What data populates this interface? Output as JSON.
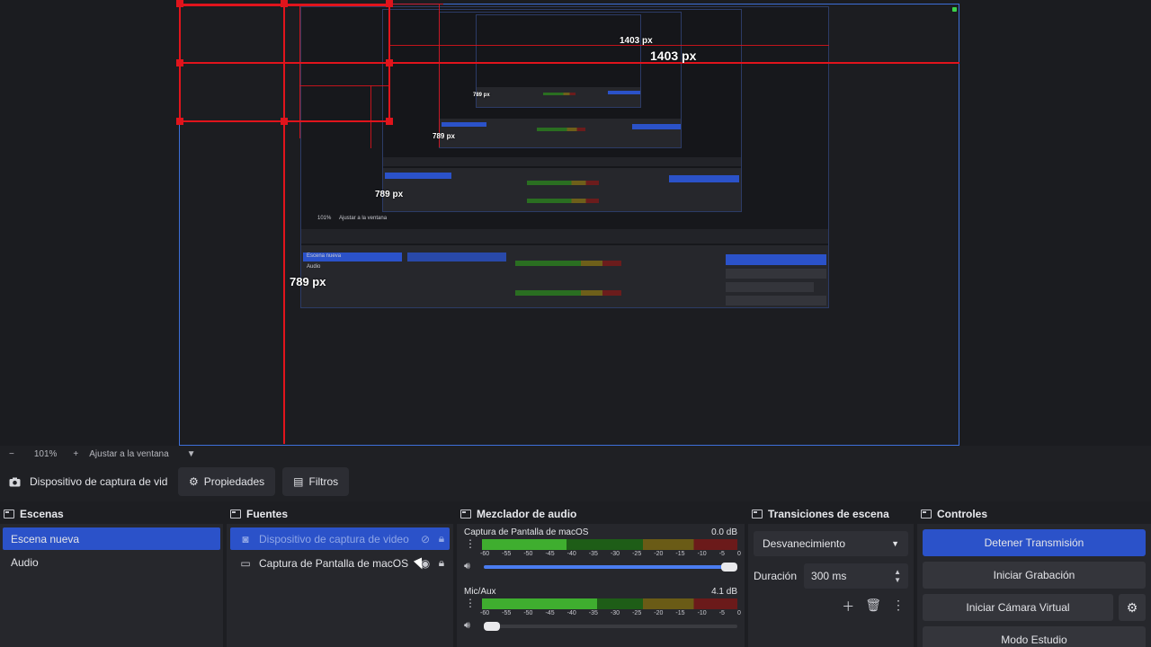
{
  "preview": {
    "labels": [
      "1403 px",
      "1403 px",
      "789 px",
      "789 px",
      "789 px",
      "789 px"
    ],
    "nested_scenes": [
      "Escena nueva",
      "Audio"
    ],
    "nested_zoom": "101%",
    "nested_fit": "Ajustar a la ventana"
  },
  "zoombar": {
    "minus": "−",
    "zoom": "101%",
    "plus": "+",
    "fit": "Ajustar a la ventana",
    "menu": "▼"
  },
  "source_toolbar": {
    "source_name": "Dispositivo de captura de vid",
    "properties_label": "Propiedades",
    "filters_label": "Filtros"
  },
  "scenes": {
    "title": "Escenas",
    "items": [
      {
        "label": "Escena nueva"
      },
      {
        "label": "Audio"
      }
    ]
  },
  "sources": {
    "title": "Fuentes",
    "items": [
      {
        "label": "Dispositivo de captura de video"
      },
      {
        "label": "Captura de Pantalla de macOS"
      }
    ]
  },
  "mixer": {
    "title": "Mezclador de audio",
    "ticks": [
      "-60",
      "-55",
      "-50",
      "-45",
      "-40",
      "-35",
      "-30",
      "-25",
      "-20",
      "-15",
      "-10",
      "-5",
      "0"
    ],
    "channels": [
      {
        "name": "Captura de Pantalla de macOS",
        "db": "0.0 dB",
        "level": 0.33,
        "volume": 1.0
      },
      {
        "name": "Mic/Aux",
        "db": "4.1 dB",
        "level": 0.45,
        "volume": 0.0
      }
    ]
  },
  "transitions": {
    "title": "Transiciones de escena",
    "selected": "Desvanecimiento",
    "duration_label": "Duración",
    "duration_value": "300 ms"
  },
  "controls": {
    "title": "Controles",
    "stop_stream": "Detener Transmisión",
    "start_recording": "Iniciar Grabación",
    "start_virtual_cam": "Iniciar Cámara Virtual",
    "studio_mode": "Modo Estudio"
  },
  "colors": {
    "accent": "#2b52c9",
    "guide_red": "#e0141c",
    "canvas_border": "#3d6fd9"
  }
}
